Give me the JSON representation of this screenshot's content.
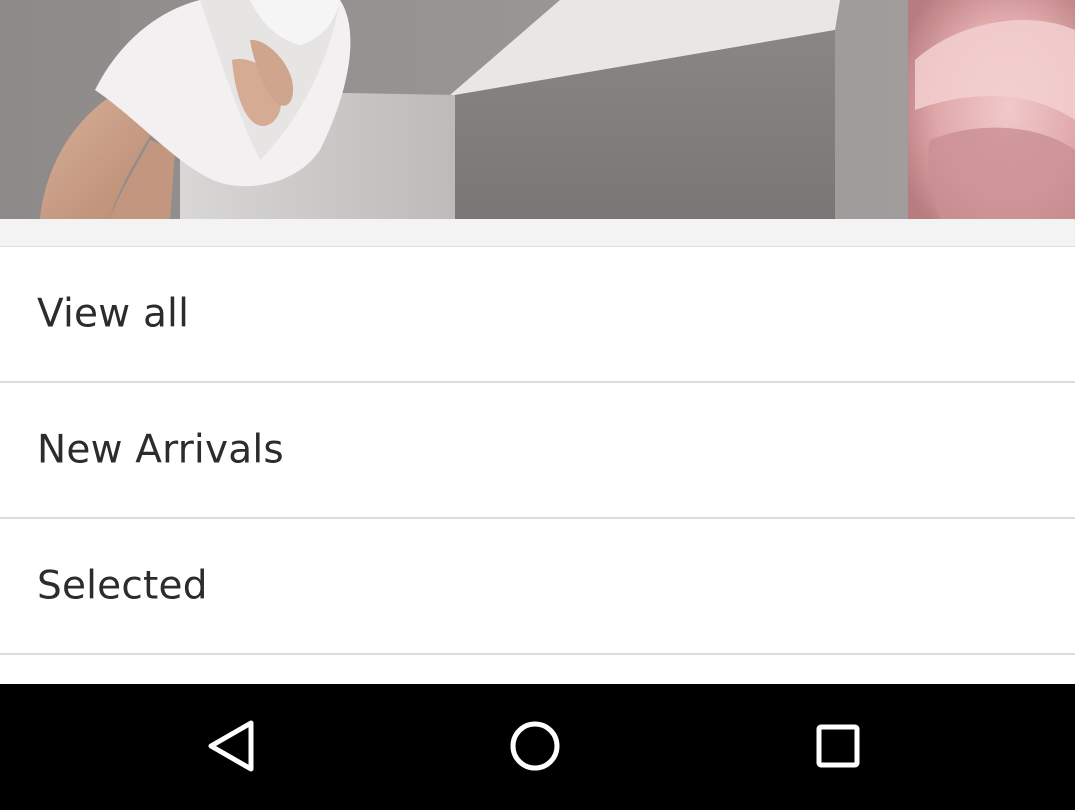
{
  "hero": {
    "alt_description": "",
    "colors": {
      "backdrop": "#8d8988",
      "box_front": "#807c7b",
      "box_top": "#ecebea",
      "dress": "#f1efef",
      "skin": "#caa08a",
      "rose": "#e9b9bb"
    }
  },
  "categories": {
    "items": [
      {
        "label": "View all"
      },
      {
        "label": "New Arrivals"
      },
      {
        "label": "Selected"
      }
    ]
  },
  "nav_bar": {
    "icons": [
      "back-icon",
      "home-icon",
      "recents-icon"
    ],
    "color": "#000000",
    "icon_color": "#ffffff"
  }
}
